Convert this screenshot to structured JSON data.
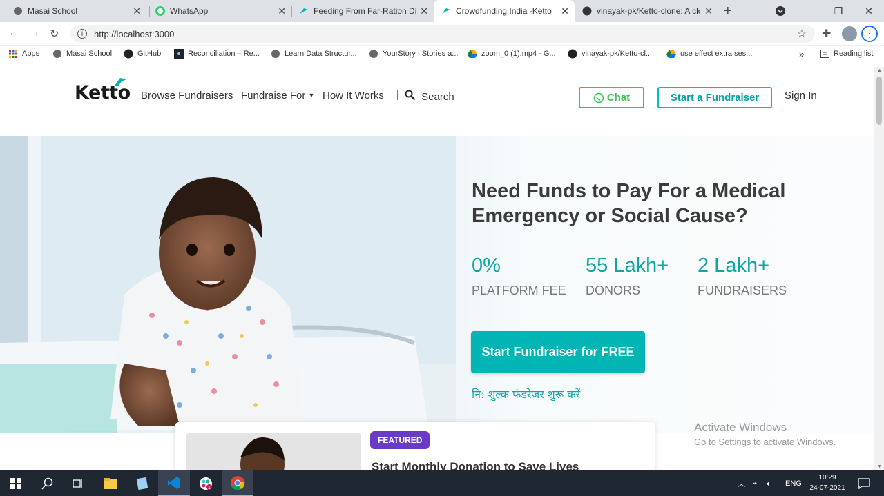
{
  "browser": {
    "tabs": [
      {
        "title": "Masai School"
      },
      {
        "title": "WhatsApp"
      },
      {
        "title": "Feeding From Far-Ration Dist"
      },
      {
        "title": "Crowdfunding India -Ketto"
      },
      {
        "title": "vinayak-pk/Ketto-clone: A clo"
      }
    ],
    "url": "http://localhost:3000",
    "bookmarks": [
      {
        "label": "Apps"
      },
      {
        "label": "Masai School"
      },
      {
        "label": "GitHub"
      },
      {
        "label": "Reconciliation – Re..."
      },
      {
        "label": "Learn Data Structur..."
      },
      {
        "label": "YourStory | Stories a..."
      },
      {
        "label": "zoom_0 (1).mp4 - G..."
      },
      {
        "label": "vinayak-pk/Ketto-cl..."
      },
      {
        "label": "use effect extra ses..."
      }
    ],
    "bookmarks_overflow": "»",
    "reading_list": "Reading list"
  },
  "site": {
    "logo": "Ketto",
    "nav": {
      "browse": "Browse Fundraisers",
      "fundraise_for": "Fundraise For",
      "how_it_works": "How It Works",
      "divider": "|",
      "search": "Search"
    },
    "chat": "Chat",
    "start_fundraiser": "Start a Fundraiser",
    "sign_in": "Sign In",
    "hero": {
      "headline_line1": "Need Funds to Pay For a Medical",
      "headline_line2": "Emergency or Social Cause?",
      "stats": [
        {
          "value": "0%",
          "label": "PLATFORM FEE"
        },
        {
          "value": "55 Lakh+",
          "label": "DONORS"
        },
        {
          "value": "2 Lakh+",
          "label": "FUNDRAISERS"
        }
      ],
      "cta": "Start Fundraiser for FREE",
      "cta_hindi": "नि: शुल्क फंडरेजर शुरू करें"
    },
    "featured": {
      "badge": "FEATURED",
      "title": "Start Monthly Donation to Save Lives"
    },
    "watermark": {
      "line1": "Activate Windows",
      "line2": "Go to Settings to activate Windows."
    }
  },
  "taskbar": {
    "language": "ENG",
    "time": "10:29",
    "date": "24-07-2021"
  },
  "colors": {
    "brand_teal": "#01b5b4",
    "chat_green": "#3ec15a",
    "featured_purple": "#6a3bc6"
  }
}
